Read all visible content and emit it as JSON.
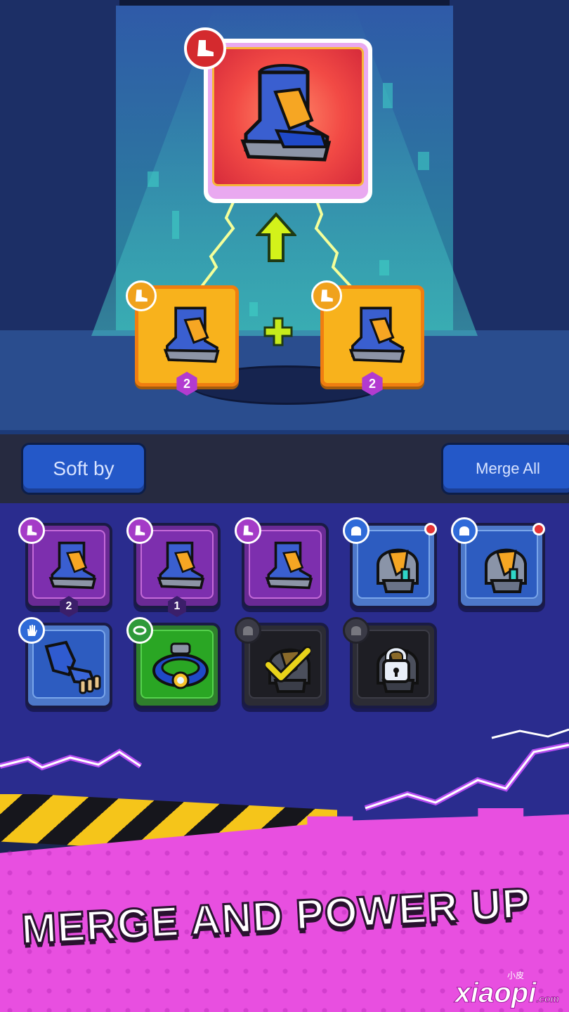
{
  "merge_preview": {
    "result_item": {
      "icon": "boot-icon",
      "category_icon": "boot-icon",
      "rarity_color": "#f24a45"
    },
    "upgrade_arrow_icon": "arrow-up-icon",
    "plus_icon": "plus-icon",
    "sources": [
      {
        "icon": "boot-icon",
        "category_icon": "boot-icon",
        "level": "2"
      },
      {
        "icon": "boot-icon",
        "category_icon": "boot-icon",
        "level": "2"
      }
    ]
  },
  "toolbar": {
    "sort_label": "Soft by",
    "merge_all_label": "Merge All"
  },
  "inventory": {
    "items": [
      {
        "icon": "boot-icon",
        "category_icon": "boot-icon",
        "rarity": "purple",
        "level": "2"
      },
      {
        "icon": "boot-icon",
        "category_icon": "boot-icon",
        "rarity": "purple",
        "level": "1"
      },
      {
        "icon": "boot-icon",
        "category_icon": "boot-icon",
        "rarity": "purple",
        "level": ""
      },
      {
        "icon": "helmet-icon",
        "category_icon": "helmet-icon",
        "rarity": "blue",
        "notification": true
      },
      {
        "icon": "helmet-icon",
        "category_icon": "helmet-icon",
        "rarity": "blue",
        "notification": true
      },
      {
        "icon": "gauntlet-icon",
        "category_icon": "hand-icon",
        "rarity": "blue"
      },
      {
        "icon": "belt-icon",
        "category_icon": "belt-icon",
        "rarity": "green"
      },
      {
        "icon": "helmet-icon",
        "category_icon": "helmet-icon",
        "rarity": "locked",
        "state": "check-icon"
      },
      {
        "icon": "helmet-icon",
        "category_icon": "helmet-icon",
        "rarity": "locked",
        "state": "lock-icon"
      }
    ]
  },
  "banner": {
    "tagline": "MERGE AND POWER UP",
    "watermark": "xiaopi",
    "watermark_small": "小皮",
    "watermark_suffix": ".com"
  }
}
